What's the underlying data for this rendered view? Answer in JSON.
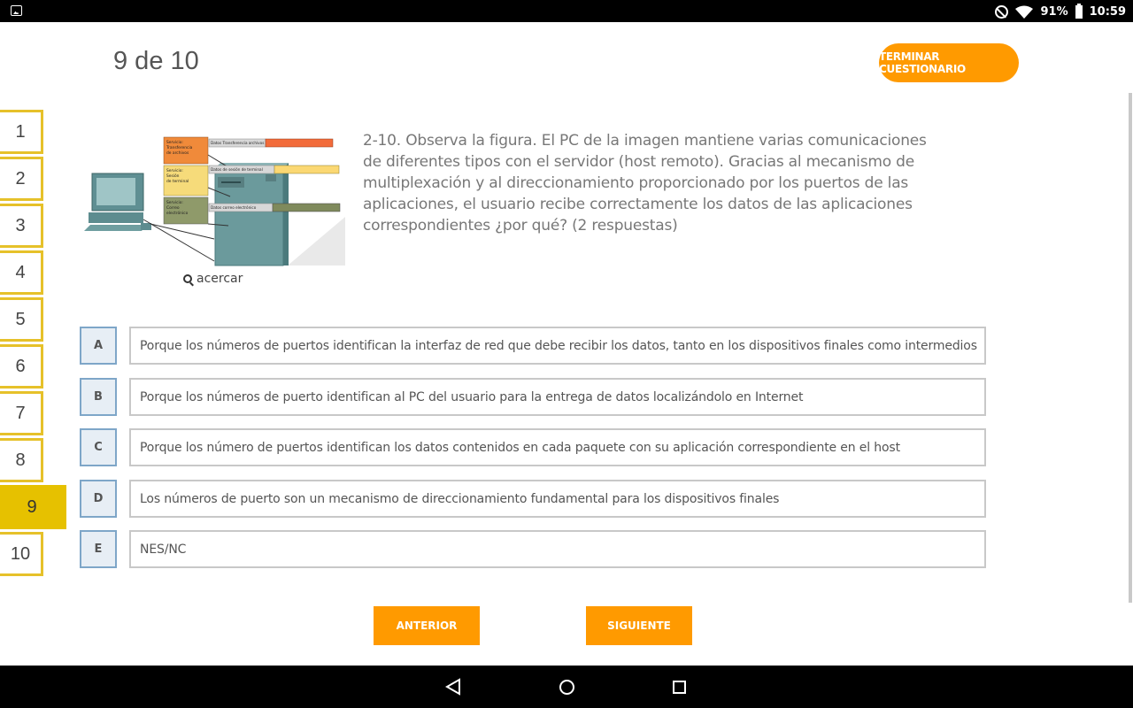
{
  "status": {
    "battery": "91%",
    "time": "10:59"
  },
  "header": {
    "counter": "9 de 10",
    "finish_label": "TERMINAR CUESTIONARIO"
  },
  "question_nav": [
    "1",
    "2",
    "3",
    "4",
    "5",
    "6",
    "7",
    "8",
    "9",
    "10"
  ],
  "active_question": "9",
  "figure": {
    "labels": {
      "svc1": [
        "Servicio:",
        "Transferencia",
        "de archivos"
      ],
      "svc2": [
        "Servicio:",
        "Sesión",
        "de terminal"
      ],
      "svc3": [
        "Servicio:",
        "Correo",
        "electrónico"
      ],
      "data1": "Datos Transferencia archivos",
      "data2": "Datos de sesión de terminal",
      "data3": "Datos correo electrónico"
    },
    "zoom_label": "acercar"
  },
  "question_text": "2-10. Observa la figura. El PC de la imagen mantiene varias comunicaciones de diferentes tipos con el servidor (host remoto). Gracias al mecanismo de multiplexación y al direccionamiento proporcionado por los puertos de las aplicaciones, el usuario recibe correctamente los datos de las aplicaciones correspondientes ¿por qué? (2 respuestas)",
  "options": [
    {
      "letter": "A",
      "text": "Porque los números de puertos identifican la interfaz de red que debe recibir los datos, tanto en los dispositivos finales como intermedios"
    },
    {
      "letter": "B",
      "text": "Porque los números de puerto identifican al PC del usuario para la entrega de datos localizándolo en Internet"
    },
    {
      "letter": "C",
      "text": "Porque los número de puertos identifican los datos contenidos en cada paquete con su aplicación correspondiente en el host"
    },
    {
      "letter": "D",
      "text": "Los números de puerto son un mecanismo de direccionamiento fundamental para los dispositivos finales"
    },
    {
      "letter": "E",
      "text": "NES/NC"
    }
  ],
  "buttons": {
    "prev": "ANTERIOR",
    "next": "SIGUIENTE"
  },
  "colors": {
    "accent": "#ff9a00",
    "active_nav": "#e6c100",
    "option_border": "#7ea6c8"
  }
}
